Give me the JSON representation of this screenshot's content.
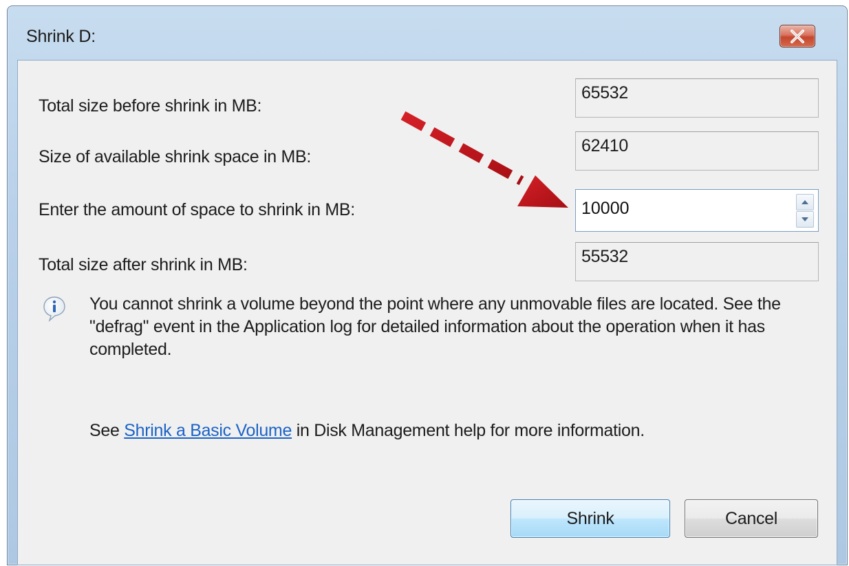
{
  "window": {
    "title": "Shrink D:"
  },
  "fields": {
    "total_before_label": "Total size before shrink in MB:",
    "total_before_value": "65532",
    "available_label": "Size of available shrink space in MB:",
    "available_value": "62410",
    "amount_label": "Enter the amount of space to shrink in MB:",
    "amount_value": "10000",
    "total_after_label": "Total size after shrink in MB:",
    "total_after_value": "55532"
  },
  "info": {
    "icon": "info-icon",
    "message": "You cannot shrink a volume beyond the point where any unmovable files are located. See the \"defrag\" event in the Application log for detailed information about the operation when it has completed."
  },
  "help": {
    "prefix": "See ",
    "link": "Shrink a Basic Volume",
    "suffix": " in Disk Management help for more information."
  },
  "buttons": {
    "shrink": "Shrink",
    "cancel": "Cancel"
  },
  "colors": {
    "annotation_arrow": "#c0141a",
    "link": "#1b63c6",
    "close_button": "#c4462d"
  }
}
